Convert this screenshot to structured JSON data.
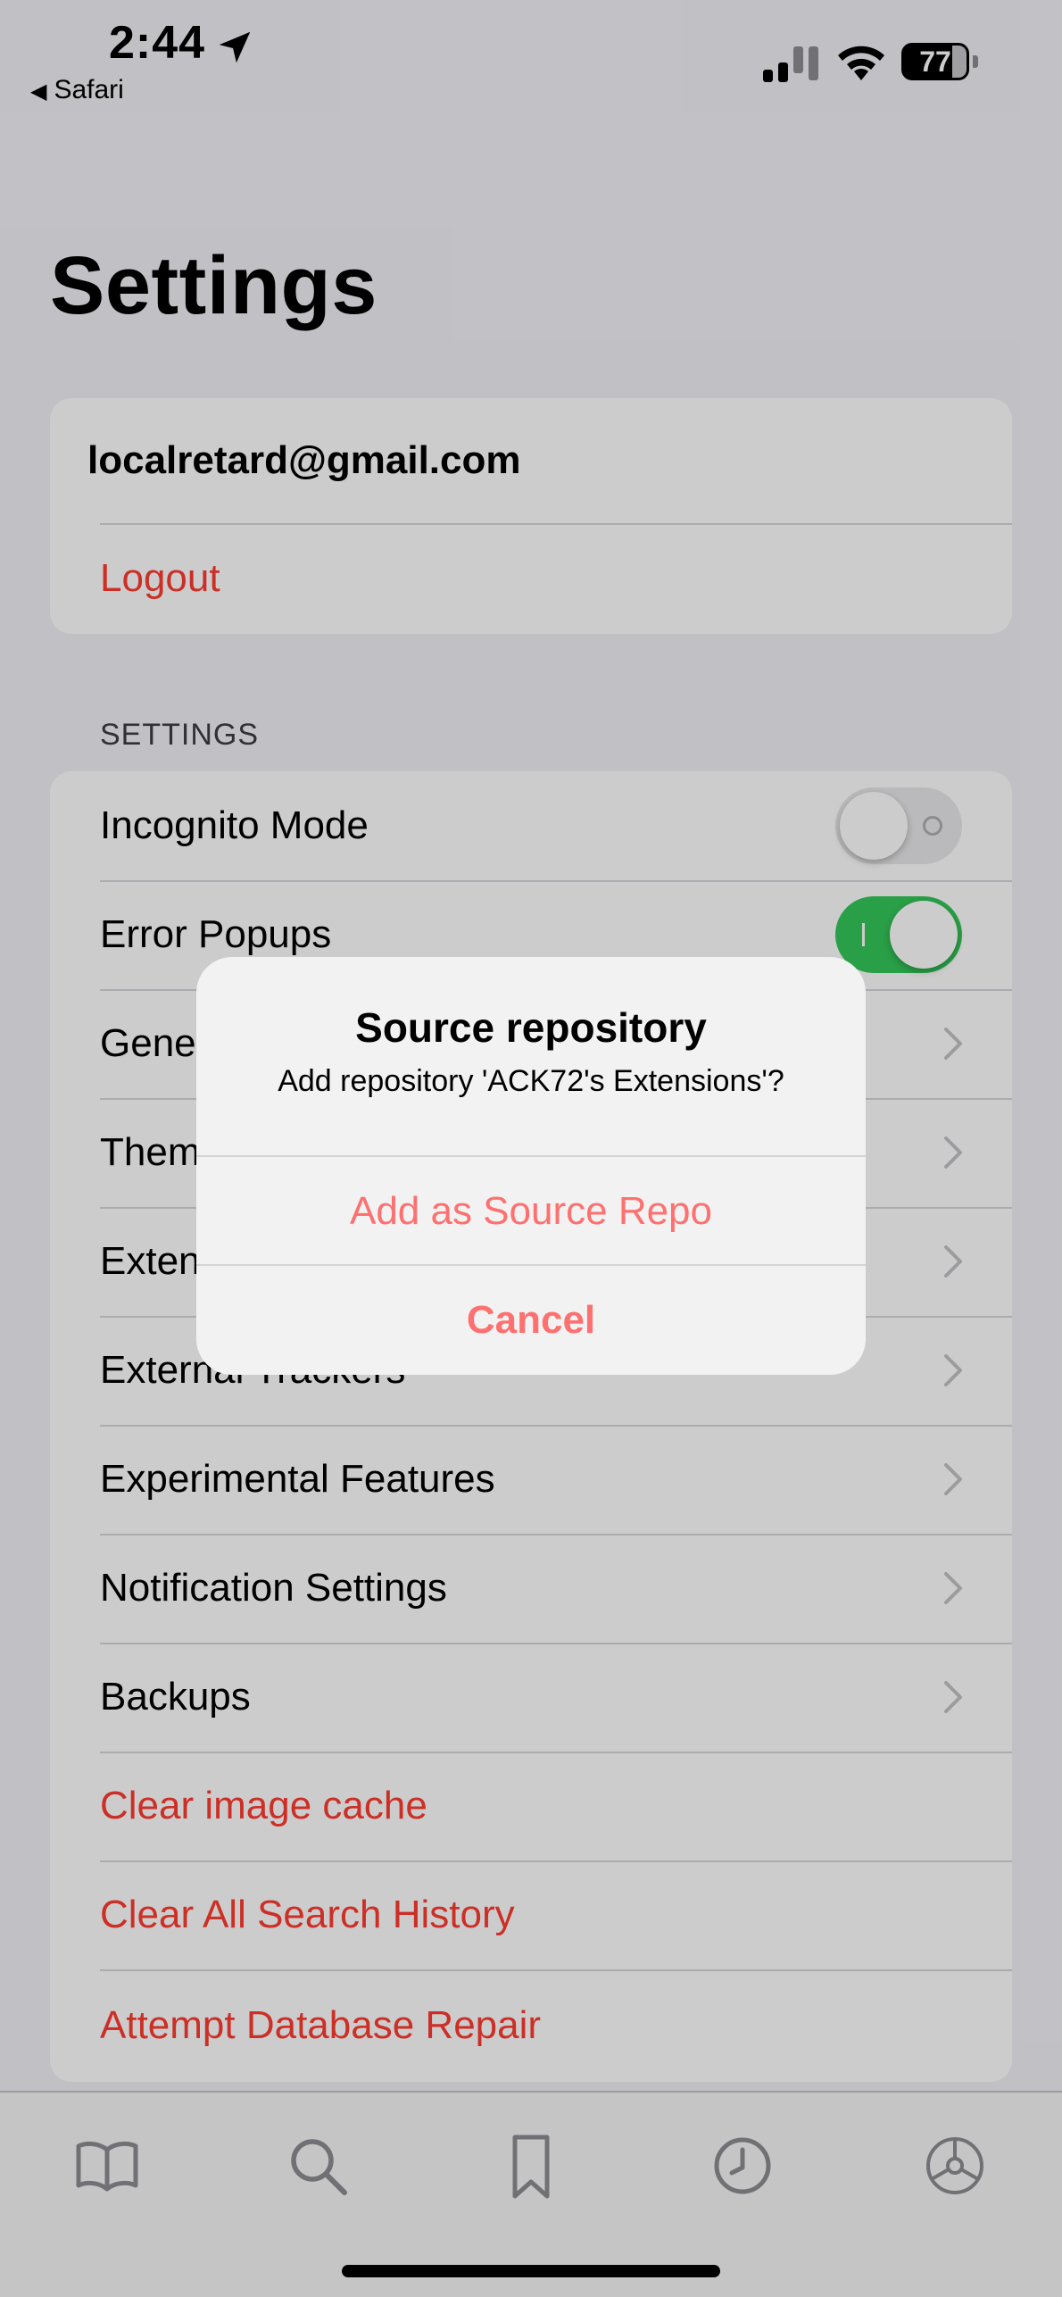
{
  "status": {
    "time": "2:44",
    "back_app": "Safari",
    "battery": "77"
  },
  "page": {
    "title": "Settings"
  },
  "account": {
    "email": "localretard@gmail.com",
    "logout": "Logout"
  },
  "settings": {
    "section_label": "SETTINGS",
    "incognito": {
      "label": "Incognito Mode",
      "on": false
    },
    "error_popups": {
      "label": "Error Popups",
      "on": true
    },
    "general": "General",
    "themes": "Themes",
    "extensions": "Extensions",
    "external_trackers": "External Trackers",
    "experimental": "Experimental Features",
    "notifications": "Notification Settings",
    "backups": "Backups",
    "clear_cache": "Clear image cache",
    "clear_history": "Clear All Search History",
    "db_repair": "Attempt Database Repair"
  },
  "tabbar": {
    "items": [
      "library-icon",
      "search-icon",
      "bookmark-icon",
      "history-icon",
      "settings-icon"
    ],
    "active": "settings"
  },
  "alert": {
    "title": "Source repository",
    "message": "Add repository 'ACK72's Extensions'?",
    "primary": "Add as Source Repo",
    "cancel": "Cancel"
  },
  "colors": {
    "destructive": "#ff3b30",
    "toggle_on": "#34c759",
    "alert_button": "#ff7070"
  }
}
